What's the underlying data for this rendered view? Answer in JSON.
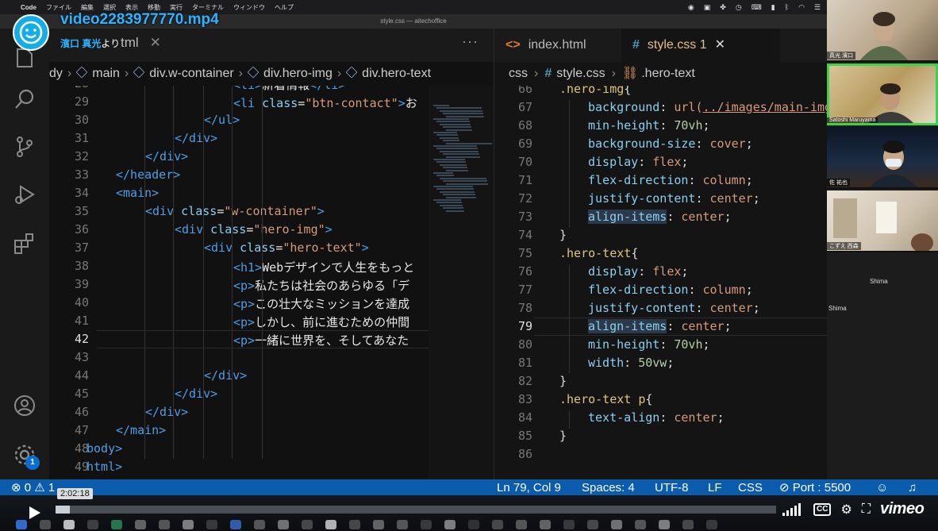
{
  "menubar": {
    "items": [
      "Code",
      "ファイル",
      "編集",
      "選択",
      "表示",
      "移動",
      "実行",
      "ターミナル",
      "ウィンドウ",
      "ヘルプ"
    ]
  },
  "window": {
    "title": "style.css — aitechoffice"
  },
  "overlay": {
    "video_title": "video2283977770.mp4",
    "uploader": "濱口 真光",
    "uploader_suffix": "より"
  },
  "left_editor": {
    "tab_label": "tml",
    "tab_close": "✕",
    "more": "···",
    "breadcrumb": [
      "dy",
      "main",
      "div.w-container",
      "div.hero-img",
      "div.hero-text"
    ],
    "lines": [
      {
        "n": "28",
        "indent": 6,
        "parts": [
          [
            "tag",
            "<li>"
          ],
          [
            "txt",
            "新着情報"
          ],
          [
            "tag",
            "</li>"
          ]
        ]
      },
      {
        "n": "29",
        "indent": 6,
        "parts": [
          [
            "tag",
            "<li "
          ],
          [
            "attr",
            "class"
          ],
          [
            "txt",
            "="
          ],
          [
            "str",
            "\"btn-contact\""
          ],
          [
            "tag",
            ">"
          ],
          [
            "txt",
            "お"
          ]
        ]
      },
      {
        "n": "30",
        "indent": 5,
        "parts": [
          [
            "tag",
            "</ul>"
          ]
        ]
      },
      {
        "n": "31",
        "indent": 4,
        "parts": [
          [
            "tag",
            "</div>"
          ]
        ]
      },
      {
        "n": "32",
        "indent": 3,
        "parts": [
          [
            "tag",
            "</div>"
          ]
        ]
      },
      {
        "n": "33",
        "indent": 2,
        "parts": [
          [
            "tag",
            "</header>"
          ]
        ]
      },
      {
        "n": "34",
        "indent": 2,
        "parts": [
          [
            "tag",
            "<main>"
          ]
        ]
      },
      {
        "n": "35",
        "indent": 3,
        "parts": [
          [
            "tag",
            "<div "
          ],
          [
            "attr",
            "class"
          ],
          [
            "txt",
            "="
          ],
          [
            "str",
            "\"w-container\""
          ],
          [
            "tag",
            ">"
          ]
        ]
      },
      {
        "n": "36",
        "indent": 4,
        "parts": [
          [
            "tag",
            "<div "
          ],
          [
            "attr",
            "class"
          ],
          [
            "txt",
            "="
          ],
          [
            "str",
            "\"hero-img\""
          ],
          [
            "tag",
            ">"
          ]
        ]
      },
      {
        "n": "37",
        "indent": 5,
        "parts": [
          [
            "tag",
            "<div "
          ],
          [
            "attr",
            "class"
          ],
          [
            "txt",
            "="
          ],
          [
            "str",
            "\"hero-text\""
          ],
          [
            "tag",
            ">"
          ]
        ]
      },
      {
        "n": "38",
        "indent": 6,
        "parts": [
          [
            "tag",
            "<h1>"
          ],
          [
            "txt",
            "Webデザインで人生をもっと"
          ]
        ]
      },
      {
        "n": "39",
        "indent": 6,
        "parts": [
          [
            "tag",
            "<p>"
          ],
          [
            "txt",
            "私たちは社会のあらゆる「デ"
          ]
        ]
      },
      {
        "n": "40",
        "indent": 6,
        "parts": [
          [
            "tag",
            "<p>"
          ],
          [
            "txt",
            "この壮大なミッションを達成"
          ]
        ]
      },
      {
        "n": "41",
        "indent": 6,
        "parts": [
          [
            "tag",
            "<p>"
          ],
          [
            "txt",
            "しかし、前に進むための仲間"
          ]
        ]
      },
      {
        "n": "42",
        "indent": 6,
        "parts": [
          [
            "tag",
            "<p>"
          ],
          [
            "txt",
            "一緒に世界を、そしてあなた"
          ]
        ]
      },
      {
        "n": "43",
        "indent": 0,
        "parts": []
      },
      {
        "n": "44",
        "indent": 5,
        "parts": [
          [
            "tag",
            "</div>"
          ]
        ]
      },
      {
        "n": "45",
        "indent": 4,
        "parts": [
          [
            "tag",
            "</div>"
          ]
        ]
      },
      {
        "n": "46",
        "indent": 3,
        "parts": [
          [
            "tag",
            "</div>"
          ]
        ]
      },
      {
        "n": "47",
        "indent": 2,
        "parts": [
          [
            "tag",
            "</main>"
          ]
        ]
      },
      {
        "n": "48",
        "indent": 1,
        "parts": [
          [
            "tag",
            "body>"
          ]
        ]
      },
      {
        "n": "49",
        "indent": 1,
        "parts": [
          [
            "tag",
            "html>"
          ]
        ]
      }
    ],
    "current_line": "42"
  },
  "right_editor": {
    "tabs": [
      {
        "icon": "<>",
        "label": "index.html"
      },
      {
        "icon": "#",
        "label": "style.css 1",
        "close": "✕"
      }
    ],
    "breadcrumb": [
      "css",
      "style.css",
      ".hero-text"
    ],
    "lines": [
      {
        "n": "66",
        "indent": 0,
        "parts": [
          [
            "sel",
            ".hero-img"
          ],
          [
            "punc",
            "{"
          ]
        ]
      },
      {
        "n": "67",
        "indent": 1,
        "parts": [
          [
            "prop",
            "background"
          ],
          [
            "punc",
            ": "
          ],
          [
            "val",
            "url("
          ],
          [
            "url",
            "../images/main-img"
          ]
        ]
      },
      {
        "n": "68",
        "indent": 1,
        "parts": [
          [
            "prop",
            "min-height"
          ],
          [
            "punc",
            ": "
          ],
          [
            "num",
            "70vh"
          ],
          [
            "punc",
            ";"
          ]
        ]
      },
      {
        "n": "69",
        "indent": 1,
        "parts": [
          [
            "prop",
            "background-size"
          ],
          [
            "punc",
            ": "
          ],
          [
            "val",
            "cover"
          ],
          [
            "punc",
            ";"
          ]
        ]
      },
      {
        "n": "70",
        "indent": 1,
        "parts": [
          [
            "prop",
            "display"
          ],
          [
            "punc",
            ": "
          ],
          [
            "val",
            "flex"
          ],
          [
            "punc",
            ";"
          ]
        ]
      },
      {
        "n": "71",
        "indent": 1,
        "parts": [
          [
            "prop",
            "flex-direction"
          ],
          [
            "punc",
            ": "
          ],
          [
            "val",
            "column"
          ],
          [
            "punc",
            ";"
          ]
        ]
      },
      {
        "n": "72",
        "indent": 1,
        "parts": [
          [
            "prop",
            "justify-content"
          ],
          [
            "punc",
            ": "
          ],
          [
            "val",
            "center"
          ],
          [
            "punc",
            ";"
          ]
        ]
      },
      {
        "n": "73",
        "indent": 1,
        "parts": [
          [
            "prop",
            "align-items"
          ],
          [
            "punc",
            ": "
          ],
          [
            "val",
            "center"
          ],
          [
            "punc",
            ";"
          ]
        ]
      },
      {
        "n": "74",
        "indent": 0,
        "parts": [
          [
            "punc",
            "}"
          ]
        ]
      },
      {
        "n": "75",
        "indent": 0,
        "parts": [
          [
            "sel",
            ".hero-text"
          ],
          [
            "punc",
            "{"
          ]
        ]
      },
      {
        "n": "76",
        "indent": 1,
        "parts": [
          [
            "prop",
            "display"
          ],
          [
            "punc",
            ": "
          ],
          [
            "val",
            "flex"
          ],
          [
            "punc",
            ";"
          ]
        ]
      },
      {
        "n": "77",
        "indent": 1,
        "parts": [
          [
            "prop",
            "flex-direction"
          ],
          [
            "punc",
            ": "
          ],
          [
            "val",
            "column"
          ],
          [
            "punc",
            ";"
          ]
        ]
      },
      {
        "n": "78",
        "indent": 1,
        "parts": [
          [
            "prop",
            "justify-content"
          ],
          [
            "punc",
            ": "
          ],
          [
            "val",
            "center"
          ],
          [
            "punc",
            ";"
          ]
        ]
      },
      {
        "n": "79",
        "indent": 1,
        "parts": [
          [
            "prop",
            "align-items"
          ],
          [
            "punc",
            ": "
          ],
          [
            "val",
            "center"
          ],
          [
            "punc",
            ";"
          ]
        ]
      },
      {
        "n": "80",
        "indent": 1,
        "parts": [
          [
            "prop",
            "min-height"
          ],
          [
            "punc",
            ": "
          ],
          [
            "num",
            "70vh"
          ],
          [
            "punc",
            ";"
          ]
        ]
      },
      {
        "n": "81",
        "indent": 1,
        "parts": [
          [
            "prop",
            "width"
          ],
          [
            "punc",
            ": "
          ],
          [
            "num",
            "50vw"
          ],
          [
            "punc",
            ";"
          ]
        ]
      },
      {
        "n": "82",
        "indent": 0,
        "parts": [
          [
            "punc",
            "}"
          ]
        ]
      },
      {
        "n": "83",
        "indent": 0,
        "parts": [
          [
            "sel",
            ".hero-text p"
          ],
          [
            "punc",
            "{"
          ]
        ]
      },
      {
        "n": "84",
        "indent": 1,
        "parts": [
          [
            "prop",
            "text-align"
          ],
          [
            "punc",
            ": "
          ],
          [
            "val",
            "center"
          ],
          [
            "punc",
            ";"
          ]
        ]
      },
      {
        "n": "85",
        "indent": 0,
        "parts": [
          [
            "punc",
            "}"
          ]
        ]
      },
      {
        "n": "86",
        "indent": 0,
        "parts": []
      }
    ],
    "current_line": "79"
  },
  "statusbar": {
    "problems": "⊗ 0 ⚠ 1",
    "position": "Ln 79, Col 9",
    "spaces": "Spaces: 4",
    "encoding": "UTF-8",
    "eol": "LF",
    "language": "CSS",
    "port": "⊘ Port : 5500"
  },
  "activity": {
    "settings_badge": "1"
  },
  "video": {
    "timecode": "2:02:18",
    "progress": 0.02,
    "brand": "vimeo",
    "cc": "CC"
  },
  "participants": [
    {
      "name": "真光 濱口"
    },
    {
      "name": "Satoshi Maruyama"
    },
    {
      "name": "佐 祐也"
    },
    {
      "name": "こずえ 西森"
    }
  ],
  "participant_labels": [
    "Shima",
    "Shima"
  ],
  "colors": {
    "statusbar": "#0b5cad",
    "accent_blue": "#2fb3ff",
    "active_speaker": "#3fd14b"
  }
}
